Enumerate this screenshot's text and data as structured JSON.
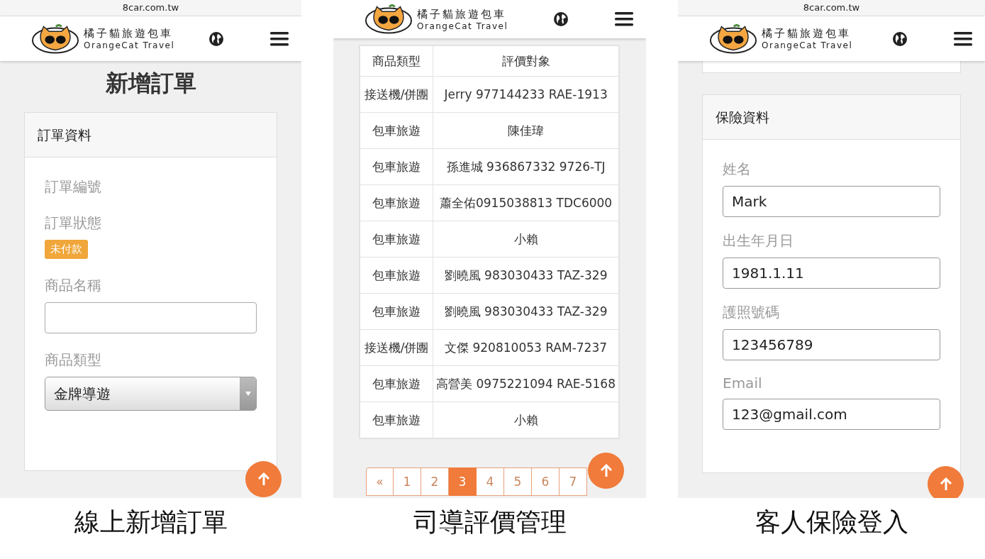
{
  "order_screen": {
    "url": "8car.com.tw",
    "brand_zh": "橘子貓旅遊包車",
    "brand_en": "OrangeCat Travel",
    "page_title": "新增訂單",
    "card_title": "訂單資料",
    "fields": [
      {
        "kind": "static",
        "label": "訂單編號"
      },
      {
        "kind": "badge",
        "label": "訂單狀態",
        "value": "未付款"
      },
      {
        "kind": "input",
        "label": "商品名稱"
      },
      {
        "kind": "select",
        "label": "商品類型",
        "value": "金牌導遊"
      }
    ],
    "caption": "線上新增訂單"
  },
  "review_screen": {
    "brand_zh": "橘子貓旅遊包車",
    "brand_en": "OrangeCat Travel",
    "columns": [
      "商品類型",
      "評價對象"
    ],
    "rows": [
      [
        "接送機/併團",
        "Jerry 977144233 RAE-1913"
      ],
      [
        "包車旅遊",
        "陳佳瑋"
      ],
      [
        "包車旅遊",
        "孫進城 936867332 9726-TJ"
      ],
      [
        "包車旅遊",
        "蕭全佑0915038813 TDC6000"
      ],
      [
        "包車旅遊",
        "小賴"
      ],
      [
        "包車旅遊",
        "劉曉風 983030433 TAZ-329"
      ],
      [
        "包車旅遊",
        "劉曉風 983030433 TAZ-329"
      ],
      [
        "接送機/併團",
        "文傑 920810053 RAM-7237"
      ],
      [
        "包車旅遊",
        "高營美 0975221094 RAE-5168"
      ],
      [
        "包車旅遊",
        "小賴"
      ]
    ],
    "pages": [
      {
        "label": "«",
        "selected": false
      },
      {
        "label": "1",
        "selected": false
      },
      {
        "label": "2",
        "selected": false
      },
      {
        "label": "3",
        "selected": true
      },
      {
        "label": "4",
        "selected": false
      },
      {
        "label": "5",
        "selected": false
      },
      {
        "label": "6",
        "selected": false
      },
      {
        "label": "7",
        "selected": false
      }
    ],
    "caption": "司導評價管理"
  },
  "insurance_screen": {
    "url": "8car.com.tw",
    "brand_zh": "橘子貓旅遊包車",
    "brand_en": "OrangeCat Travel",
    "card_title": "保險資料",
    "fields": [
      {
        "label": "姓名",
        "value": "Mark"
      },
      {
        "label": "出生年月日",
        "value": "1981.1.11"
      },
      {
        "label": "護照號碼",
        "value": "123456789"
      },
      {
        "label": "Email",
        "value": "123@gmail.com"
      }
    ],
    "caption": "客人保險登入"
  }
}
